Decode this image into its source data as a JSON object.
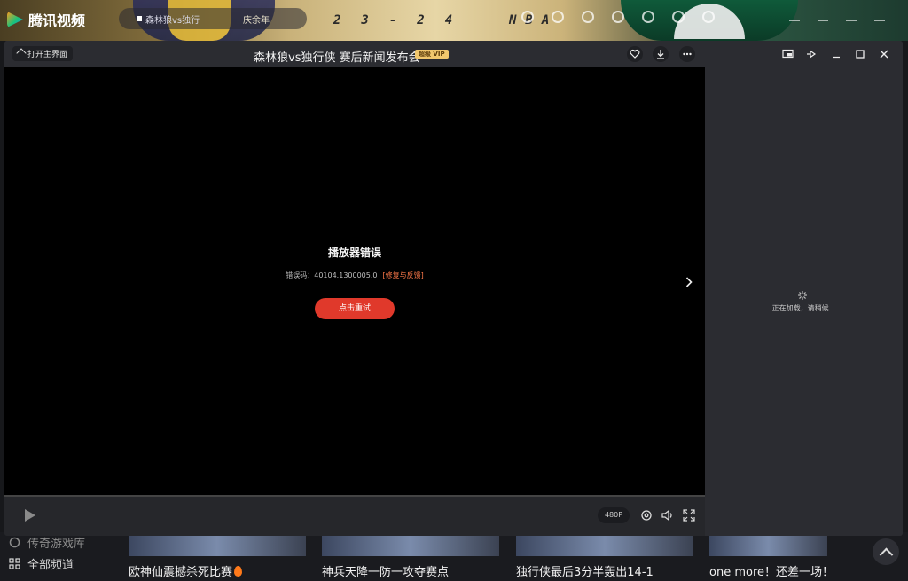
{
  "background_app": {
    "app_name": "腾讯视频",
    "search": {
      "query": "森林狼vs独行",
      "hint": "庆余年"
    },
    "banner": {
      "season": "23-24",
      "league": "NBA"
    },
    "sidebar": [
      {
        "label": "传奇游戏库",
        "icon": "game-icon"
      },
      {
        "label": "全部频道",
        "icon": "grid-icon"
      }
    ],
    "recommendations": [
      {
        "title": "欧神仙震撼杀死比赛",
        "hot": true
      },
      {
        "title": "神兵天降一防一攻夺赛点"
      },
      {
        "title": "独行侠最后3分半轰出14-1"
      },
      {
        "title": "one more！还差一场！"
      }
    ]
  },
  "player": {
    "home_button": "打开主界面",
    "title": "森林狼vs独行侠 赛后新闻发布会",
    "vip_badge": "超级 VIP",
    "error": {
      "title": "播放器错误",
      "code_label": "错误码：",
      "code": "40104.1300005.0",
      "fix_link": "[修复与反馈]",
      "retry_button": "点击重试"
    },
    "side_panel": {
      "loading_text": "正在加载，请稍候..."
    },
    "controls": {
      "quality": "480P"
    }
  },
  "colors": {
    "accent_red": "#e0392b",
    "vip_gold": "#f1c76d",
    "fix_link": "#ff7a4a",
    "panel": "#2b2c31"
  }
}
